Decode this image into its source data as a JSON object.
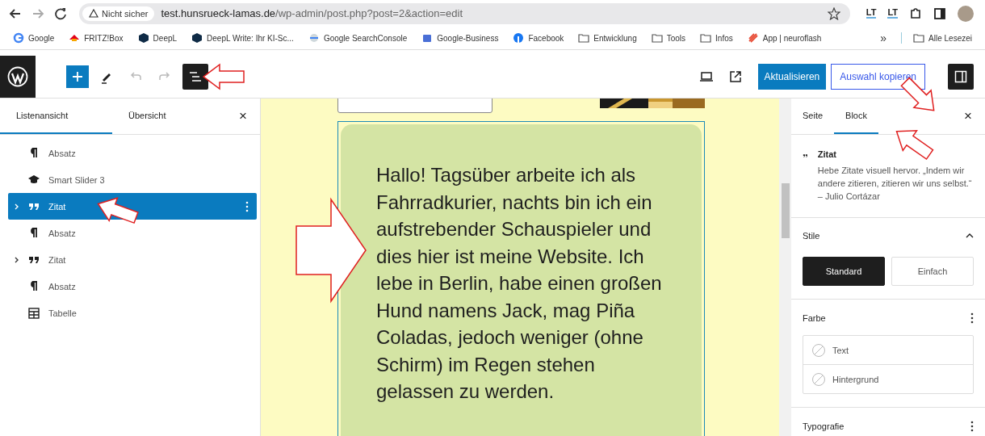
{
  "browser": {
    "security": "Nicht sicher",
    "url_host": "test.hunsrueck-lamas.de",
    "url_path": "/wp-admin/post.php?post=2&action=edit",
    "extensions": [
      "LT",
      "LT"
    ],
    "bookmarks": [
      {
        "kind": "google",
        "label": "Google"
      },
      {
        "kind": "fritz",
        "label": "FRITZ!Box"
      },
      {
        "kind": "deepl",
        "label": "DeepL"
      },
      {
        "kind": "deepl",
        "label": "DeepL Write: Ihr KI-Sc..."
      },
      {
        "kind": "console",
        "label": "Google SearchConsole"
      },
      {
        "kind": "business",
        "label": "Google-Business"
      },
      {
        "kind": "facebook",
        "label": "Facebook"
      },
      {
        "kind": "folder",
        "label": "Entwicklung"
      },
      {
        "kind": "folder",
        "label": "Tools"
      },
      {
        "kind": "folder",
        "label": "Infos"
      },
      {
        "kind": "app",
        "label": "App | neuroflash"
      }
    ],
    "overflow": "»",
    "other_bookmarks": "Alle Lesezei"
  },
  "toolbar": {
    "update_button": "Aktualisieren",
    "copy_button": "Auswahl kopieren",
    "list_view_on": true,
    "settings_on": true
  },
  "list_panel": {
    "tabs": [
      {
        "label": "Listenansicht",
        "selected": true
      },
      {
        "label": "Übersicht",
        "selected": false
      }
    ],
    "close": "×",
    "items": [
      {
        "kind": "paragraph",
        "label": "Absatz",
        "selected": false,
        "expandable": false
      },
      {
        "kind": "slider",
        "label": "Smart Slider 3",
        "selected": false,
        "expandable": false
      },
      {
        "kind": "quote",
        "label": "Zitat",
        "selected": true,
        "expandable": true
      },
      {
        "kind": "paragraph",
        "label": "Absatz",
        "selected": false,
        "expandable": false
      },
      {
        "kind": "quote",
        "label": "Zitat",
        "selected": false,
        "expandable": true
      },
      {
        "kind": "paragraph",
        "label": "Absatz",
        "selected": false,
        "expandable": false
      },
      {
        "kind": "table",
        "label": "Tabelle",
        "selected": false,
        "expandable": false
      }
    ]
  },
  "canvas": {
    "quote_text": "Hallo! Tagsüber arbeite ich als Fahrradkurier, nachts bin ich ein aufstrebender Schauspieler und dies hier ist meine Website. Ich lebe in Berlin, habe einen großen Hund namens Jack, mag Piña Coladas, jedoch weniger (ohne Schirm) im Regen stehen gelassen zu werden."
  },
  "settings_panel": {
    "tabs": [
      {
        "label": "Seite",
        "selected": false
      },
      {
        "label": "Block",
        "selected": true
      }
    ],
    "close": "×",
    "block": {
      "title": "Zitat",
      "description": "Hebe Zitate visuell hervor. „Indem wir andere zitieren, zitieren wir uns selbst.“ – Julio Cortázar"
    },
    "styles": {
      "title": "Stile",
      "expanded": true,
      "options": [
        {
          "label": "Standard",
          "selected": true
        },
        {
          "label": "Einfach",
          "selected": false
        }
      ]
    },
    "color": {
      "title": "Farbe",
      "items": [
        {
          "label": "Text"
        },
        {
          "label": "Hintergrund"
        }
      ]
    },
    "typography": {
      "title": "Typografie"
    }
  }
}
